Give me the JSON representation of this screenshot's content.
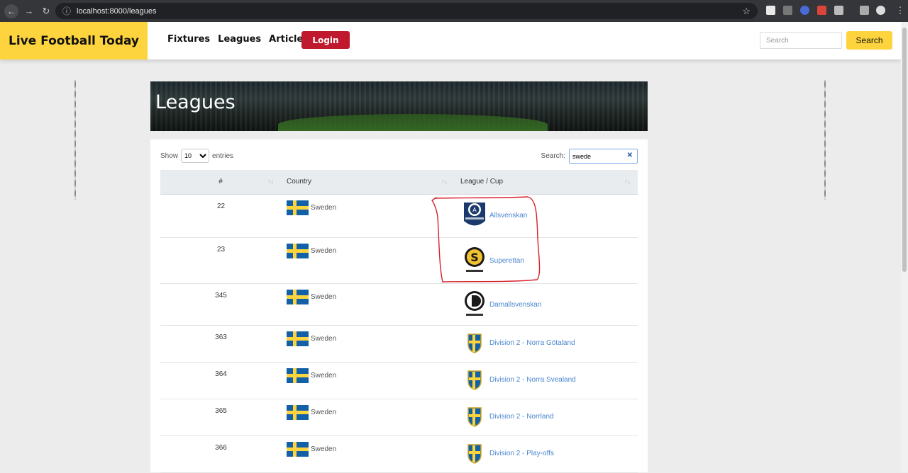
{
  "browser": {
    "url": "localhost:8000/leagues"
  },
  "header": {
    "brand": "Live Football Today",
    "nav": [
      "Fixtures",
      "Leagues",
      "Articles"
    ],
    "login_label": "Login",
    "search_placeholder": "Search",
    "search_button": "Search"
  },
  "banner": {
    "title": "Leagues"
  },
  "table_controls": {
    "show_label": "Show",
    "entries_label": "entries",
    "page_size": "10",
    "search_label": "Search:",
    "search_value": "swede"
  },
  "table": {
    "columns": [
      "#",
      "Country",
      "League / Cup"
    ],
    "rows": [
      {
        "id": "22",
        "country": "Sweden",
        "league": "Allsvenskan",
        "logo": "allsvenskan-logo"
      },
      {
        "id": "23",
        "country": "Sweden",
        "league": "Superettan",
        "logo": "superettan-logo"
      },
      {
        "id": "345",
        "country": "Sweden",
        "league": "Damallsvenskan",
        "logo": "damallsvenskan-logo"
      },
      {
        "id": "363",
        "country": "Sweden",
        "league": "Division 2 - Norra Götaland",
        "logo": "swedish-fa-crest"
      },
      {
        "id": "364",
        "country": "Sweden",
        "league": "Division 2 - Norra Svealand",
        "logo": "swedish-fa-crest"
      },
      {
        "id": "365",
        "country": "Sweden",
        "league": "Division 2 - Norrland",
        "logo": "swedish-fa-crest"
      },
      {
        "id": "366",
        "country": "Sweden",
        "league": "Division 2 - Play-offs",
        "logo": "swedish-fa-crest"
      }
    ]
  },
  "colors": {
    "brand_yellow": "#fdd43d",
    "login_red": "#c0182c",
    "link_blue": "#4a86cf",
    "annotation_red": "#d6202a"
  }
}
